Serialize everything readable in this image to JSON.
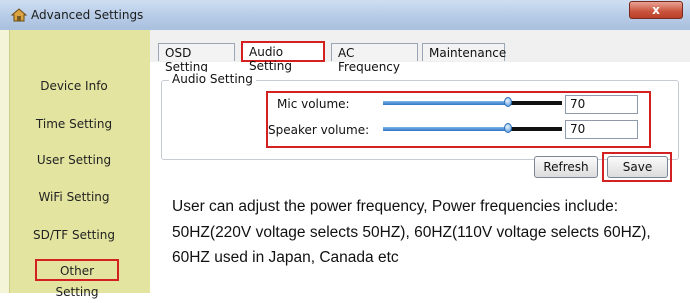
{
  "window": {
    "title": "Advanced Settings",
    "close_label": "x"
  },
  "sidebar": {
    "items": [
      {
        "label": "Device Info"
      },
      {
        "label": "Time Setting"
      },
      {
        "label": "User Setting"
      },
      {
        "label": "WiFi Setting"
      },
      {
        "label": "SD/TF Setting"
      },
      {
        "label": "Other Setting",
        "selected": true
      }
    ]
  },
  "tabs": [
    {
      "label": "OSD Setting"
    },
    {
      "label": "Audio Setting",
      "active": true
    },
    {
      "label": "AC Frequency"
    },
    {
      "label": "Maintenance"
    }
  ],
  "audio": {
    "group_label": "Audio Setting",
    "mic": {
      "label": "Mic volume:",
      "value": "70",
      "slider_fraction": 0.7
    },
    "speaker": {
      "label": "Speaker volume:",
      "value": "70",
      "slider_fraction": 0.7
    }
  },
  "buttons": {
    "refresh": "Refresh",
    "save": "Save"
  },
  "note": "User can adjust the power frequency, Power frequencies include: 50HZ(220V voltage selects 50HZ), 60HZ(110V voltage selects 60HZ), 60HZ used in Japan, Canada etc",
  "colors": {
    "highlight_red": "#d32020",
    "sidebar_bg": "#e2e4a0",
    "slider_blue": "#2f74c5"
  }
}
